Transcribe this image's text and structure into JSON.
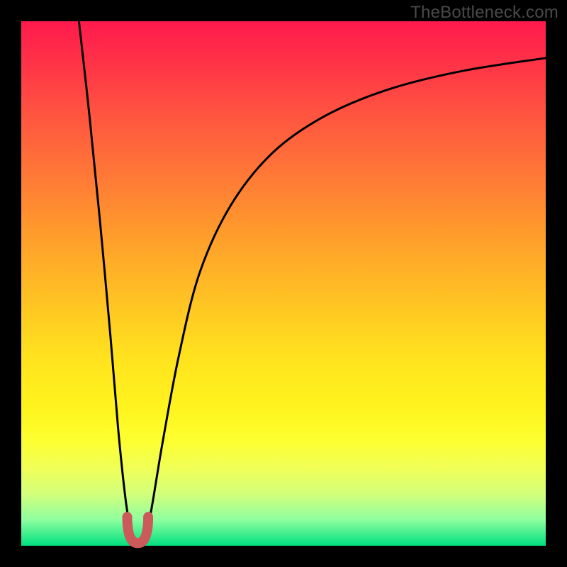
{
  "watermark": "TheBottleneck.com",
  "chart_data": {
    "type": "line",
    "title": "",
    "xlabel": "",
    "ylabel": "",
    "xlim": [
      0,
      100
    ],
    "ylim": [
      0,
      100
    ],
    "series": [
      {
        "name": "bottleneck-curve",
        "x": [
          11,
          13,
          15,
          17,
          18.5,
          20,
          21,
          22,
          23,
          24,
          25,
          27,
          30,
          34,
          40,
          48,
          58,
          70,
          84,
          100
        ],
        "values": [
          100,
          82,
          62,
          40,
          22,
          8,
          3,
          1,
          1,
          3,
          8,
          20,
          36,
          52,
          65,
          75,
          82,
          87,
          90.5,
          93
        ]
      }
    ],
    "annotations": [
      {
        "name": "minimum-marker",
        "x_range": [
          20.2,
          24.2
        ],
        "y_range": [
          0.5,
          5.5
        ],
        "color": "#cc5a5a"
      }
    ],
    "gradient_bands": [
      {
        "y": 100,
        "color": "#ff1a4d"
      },
      {
        "y": 50,
        "color": "#ffbf24"
      },
      {
        "y": 10,
        "color": "#fdff30"
      },
      {
        "y": 0,
        "color": "#00e080"
      }
    ]
  }
}
